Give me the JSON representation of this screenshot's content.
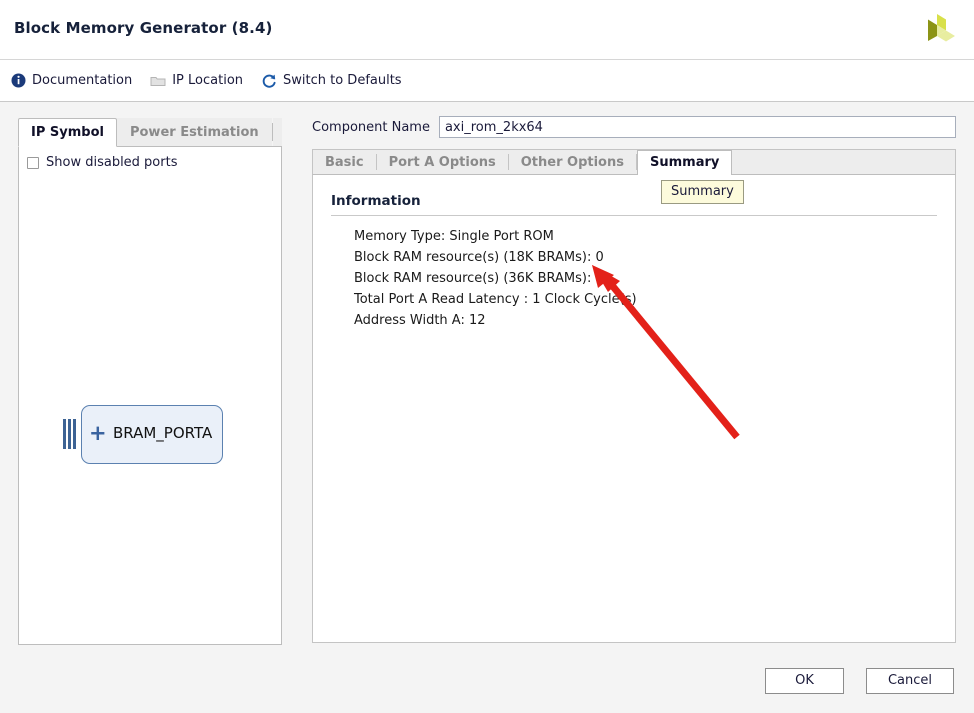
{
  "window": {
    "title": "Block Memory Generator (8.4)",
    "logo_icon": "xilinx-logo-icon",
    "logo_colors": {
      "dark": "#8c9416",
      "mid": "#d8e04a",
      "light": "#e8eda0"
    }
  },
  "toolbar": {
    "items": [
      {
        "label": "Documentation",
        "icon": "info-icon"
      },
      {
        "label": "IP Location",
        "icon": "folder-icon"
      },
      {
        "label": "Switch to Defaults",
        "icon": "refresh-icon"
      }
    ]
  },
  "left_panel": {
    "tabs": [
      {
        "label": "IP Symbol",
        "active": true
      },
      {
        "label": "Power Estimation",
        "active": false
      }
    ],
    "show_disabled_ports": {
      "label": "Show disabled ports",
      "checked": false
    },
    "symbol": {
      "name": "BRAM_PORTA",
      "expander": "+",
      "connector_icon": "bus-connector-icon"
    }
  },
  "right_panel": {
    "component_name": {
      "label": "Component Name",
      "value": "axi_rom_2kx64",
      "placeholder": ""
    },
    "tabs": [
      {
        "label": "Basic",
        "active": false
      },
      {
        "label": "Port A Options",
        "active": false
      },
      {
        "label": "Other Options",
        "active": false
      },
      {
        "label": "Summary",
        "active": true
      }
    ],
    "tooltip": "Summary",
    "information": {
      "heading": "Information",
      "rows": [
        "Memory Type: Single Port ROM",
        "Block RAM resource(s) (18K BRAMs): 0",
        "Block RAM resource(s) (36K BRAMs): 8",
        "Total Port A Read Latency : 1 Clock Cycle(s)",
        "Address Width A: 12"
      ]
    }
  },
  "footer": {
    "ok_label": "OK",
    "cancel_label": "Cancel"
  },
  "annotation": {
    "arrow_color": "#e32119",
    "arrow_name": "red-arrow-annotation"
  }
}
